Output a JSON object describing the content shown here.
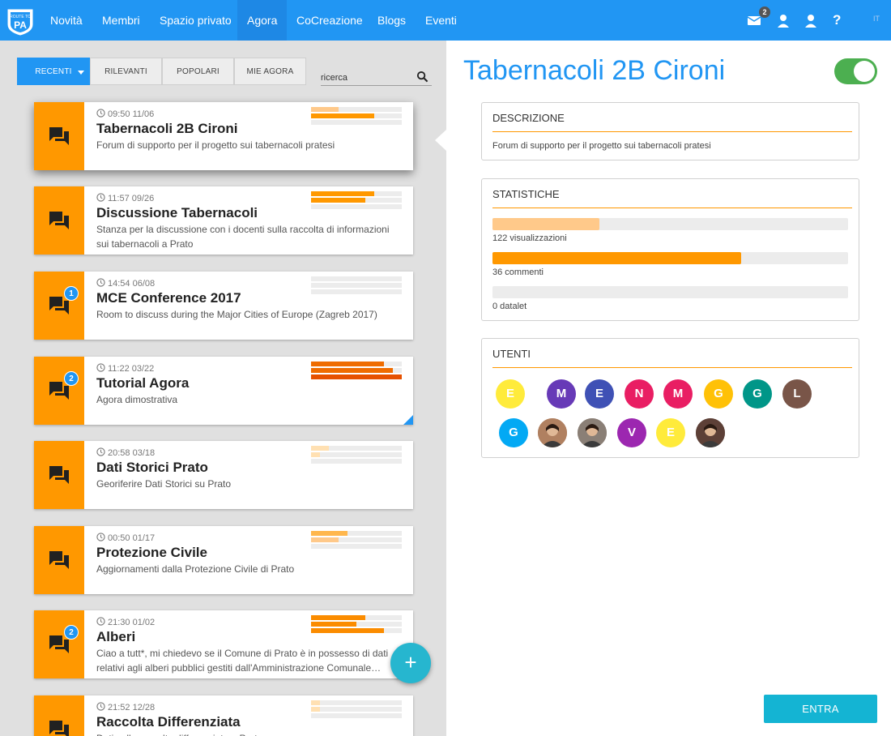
{
  "app": {
    "logo_text": "PA",
    "logo_arc_text": "ROUTE TO"
  },
  "nav": {
    "items": [
      "Novità",
      "Membri",
      "Spazio privato",
      "Agora",
      "CoCreazione",
      "Blogs",
      "Eventi"
    ],
    "active": "Agora"
  },
  "topbar_icons": {
    "messages_badge": "2",
    "help": "?",
    "language": "IT"
  },
  "filters": {
    "tabs": [
      "RECENTI",
      "RILEVANTI",
      "POPOLARI",
      "MIE AGORA"
    ],
    "active": "RECENTI",
    "search_placeholder": "ricerca"
  },
  "rooms": [
    {
      "time": "09:50 11/06",
      "title": "Tabernacoli 2B Cironi",
      "desc": "Forum di supporto per il progetto sui tabernacoli pratesi",
      "badge": "",
      "bars": [
        {
          "v": 0.3,
          "c": "#ffc98a"
        },
        {
          "v": 0.7,
          "c": "#ff9800"
        },
        {
          "v": 0,
          "c": "#ececec"
        }
      ]
    },
    {
      "time": "11:57 09/26",
      "title": "Discussione Tabernacoli",
      "desc": "Stanza per la discussione con i docenti sulla raccolta di informazioni sui tabernacoli a Prato",
      "badge": "",
      "bars": [
        {
          "v": 0.7,
          "c": "#ff9800"
        },
        {
          "v": 0.6,
          "c": "#ff9800"
        },
        {
          "v": 0,
          "c": "#ececec"
        }
      ]
    },
    {
      "time": "14:54 06/08",
      "title": "MCE Conference 2017",
      "desc": "Room to discuss during the Major Cities of Europe (Zagreb 2017)",
      "badge": "1",
      "bars": [
        {
          "v": 0,
          "c": "#ececec"
        },
        {
          "v": 0,
          "c": "#ececec"
        },
        {
          "v": 0,
          "c": "#ececec"
        }
      ]
    },
    {
      "time": "11:22 03/22",
      "title": "Tutorial Agora",
      "desc": "Agora dimostrativa",
      "badge": "2",
      "bars": [
        {
          "v": 0.8,
          "c": "#ef6c00"
        },
        {
          "v": 0.9,
          "c": "#ef6c00"
        },
        {
          "v": 1.0,
          "c": "#e65100"
        }
      ]
    },
    {
      "time": "20:58 03/18",
      "title": "Dati Storici Prato",
      "desc": "Georiferire Dati Storici su Prato",
      "badge": "",
      "bars": [
        {
          "v": 0.2,
          "c": "#ffe0b2"
        },
        {
          "v": 0.1,
          "c": "#ffe0b2"
        },
        {
          "v": 0,
          "c": "#ececec"
        }
      ]
    },
    {
      "time": "00:50 01/17",
      "title": "Protezione Civile",
      "desc": "Aggiornamenti dalla Protezione Civile di Prato",
      "badge": "",
      "bars": [
        {
          "v": 0.4,
          "c": "#ffb74d"
        },
        {
          "v": 0.3,
          "c": "#ffc98a"
        },
        {
          "v": 0,
          "c": "#ececec"
        }
      ]
    },
    {
      "time": "21:30 01/02",
      "title": "Alberi",
      "desc": "Ciao a tutt*, mi chiedevo se il Comune di Prato è in possesso di dati relativi agli alberi pubblici gestiti dall'Amministrazione Comunale…",
      "badge": "2",
      "bars": [
        {
          "v": 0.6,
          "c": "#fb8c00"
        },
        {
          "v": 0.5,
          "c": "#fb8c00"
        },
        {
          "v": 0.8,
          "c": "#fb8c00"
        }
      ]
    },
    {
      "time": "21:52 12/28",
      "title": "Raccolta Differenziata",
      "desc": "Dati sulla raccolta differenziata a Prato",
      "badge": "",
      "bars": [
        {
          "v": 0.1,
          "c": "#ffe0b2"
        },
        {
          "v": 0.1,
          "c": "#ffe0b2"
        },
        {
          "v": 0,
          "c": "#ececec"
        }
      ]
    }
  ],
  "detail": {
    "title": "Tabernacoli 2B Cironi",
    "description_heading": "DESCRIZIONE",
    "description": "Forum di supporto per il progetto sui tabernacoli pratesi",
    "stats_heading": "STATISTICHE",
    "stats": [
      {
        "label": "122 visualizzazioni",
        "fill": 0.3,
        "color": "#ffc98a"
      },
      {
        "label": "36 commenti",
        "fill": 0.7,
        "color": "#ff9800"
      },
      {
        "label": "0 datalet",
        "fill": 0.0,
        "color": "#ececec"
      }
    ],
    "users_heading": "UTENTI",
    "users": [
      {
        "initial": "E",
        "color": "#ffeb3b"
      },
      {
        "initial": "M",
        "color": "#673ab7"
      },
      {
        "initial": "E",
        "color": "#3f51b5"
      },
      {
        "initial": "N",
        "color": "#e91e63"
      },
      {
        "initial": "M",
        "color": "#e91e63"
      },
      {
        "initial": "G",
        "color": "#ffc107"
      },
      {
        "initial": "G",
        "color": "#009688"
      },
      {
        "initial": "L",
        "color": "#795548"
      },
      {
        "initial": "G",
        "color": "#03a9f4"
      },
      {
        "initial": "",
        "color": "#b08060",
        "photo": true
      },
      {
        "initial": "",
        "color": "#8a7f76",
        "photo": true
      },
      {
        "initial": "V",
        "color": "#9c27b0"
      },
      {
        "initial": "E",
        "color": "#ffeb3b"
      },
      {
        "initial": "",
        "color": "#5d4037",
        "photo": true
      }
    ],
    "enter_label": "ENTRA",
    "published": true
  },
  "colors": {
    "primary": "#2196f3",
    "accent_orange": "#ff9800",
    "fab": "#26b6cf",
    "toggle_on": "#4caf50"
  }
}
